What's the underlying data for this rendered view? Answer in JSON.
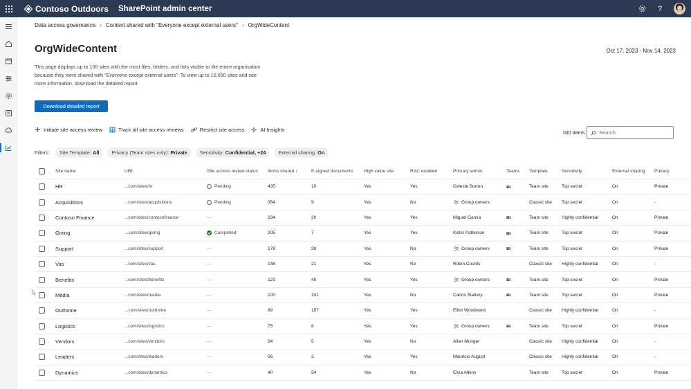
{
  "topbar": {
    "brand": "Contoso Outdoors",
    "app": "SharePoint admin center"
  },
  "icons": {
    "waffle": "app-launcher-icon",
    "settings": "gear-icon",
    "help": "help-icon",
    "search": "search-icon"
  },
  "breadcrumb": [
    "Data access governance",
    "Content shared with \"Everyone except external users\"",
    "OrgWideContent"
  ],
  "page": {
    "title": "OrgWideContent",
    "date_range": "Oct 17, 2023 - Nov 14, 2023",
    "description": "This page displays up to 100 sites with the most files, folders, and lists visible to the entire organisation because they were shared with \"Everyone except external users\". To view up to 10,000 sites and see more information, download the detailed report.",
    "download_button": "Download detailed report"
  },
  "commands": [
    {
      "label": "Initiate site access review",
      "icon": "add-icon"
    },
    {
      "label": "Track all site access reviews",
      "icon": "grid-icon"
    },
    {
      "label": "Restrict site access",
      "icon": "link-icon"
    },
    {
      "label": "AI Insights",
      "icon": "sparkle-icon"
    }
  ],
  "items_count": "100 items",
  "search_placeholder": "Search",
  "filters": {
    "label": "Filters:",
    "pills": [
      {
        "name": "Site Template:",
        "value": "All"
      },
      {
        "name": "Privacy (Team sites only):",
        "value": "Private"
      },
      {
        "name": "Sensitivity:",
        "value": "Confidential, +24"
      },
      {
        "name": "External sharing:",
        "value": "On"
      }
    ]
  },
  "columns": {
    "site_name": "Site name",
    "url": "URL",
    "status": "Site access review status",
    "items": "Items shared ↓",
    "esign": "E-signed documents",
    "hv": "High value site",
    "rac": "RAC enabled",
    "admin": "Primary admin",
    "teams": "Teams",
    "template": "Template",
    "sens": "Sensitivity",
    "ext": "External sharing",
    "priv": "Privacy"
  },
  "rows": [
    {
      "name": "HR",
      "url": "...com/sites/hr",
      "status": "Pending",
      "status_type": "pending",
      "items": "435",
      "esign": "10",
      "hv": "Yes",
      "rac": "Yes",
      "admin": "Celeste Burton",
      "admin_group": false,
      "teams": true,
      "template": "Team site",
      "sens": "Top secret",
      "ext": "On",
      "priv": "Private"
    },
    {
      "name": "Acquisitions",
      "url": "...com/sites/acquisitions",
      "status": "Pending",
      "status_type": "pending",
      "items": "354",
      "esign": "9",
      "hv": "Yes",
      "rac": "No",
      "admin": "Group owners",
      "admin_group": true,
      "teams": false,
      "template": "Classic site",
      "sens": "Top secret",
      "ext": "On",
      "priv": "-"
    },
    {
      "name": "Contoso Finance",
      "url": "...com/sites/contosofinance",
      "status": "—",
      "status_type": "none",
      "items": "234",
      "esign": "20",
      "hv": "Yes",
      "rac": "Yes",
      "admin": "Miguel Garcia",
      "admin_group": false,
      "teams": true,
      "template": "Team site",
      "sens": "Highly confidential",
      "ext": "On",
      "priv": "Private"
    },
    {
      "name": "Giving",
      "url": "...com/sites/giving",
      "status": "Completed",
      "status_type": "completed",
      "items": "205",
      "esign": "7",
      "hv": "Yes",
      "rac": "Yes",
      "admin": "Kistin Patterson",
      "admin_group": false,
      "teams": true,
      "template": "Team site",
      "sens": "Top secret",
      "ext": "On",
      "priv": "Private"
    },
    {
      "name": "Support",
      "url": "...com/sites/support",
      "status": "—",
      "status_type": "none",
      "items": "178",
      "esign": "38",
      "hv": "Yes",
      "rac": "No",
      "admin": "Group owners",
      "admin_group": true,
      "teams": true,
      "template": "Team site",
      "sens": "Top secret",
      "ext": "On",
      "priv": "Private"
    },
    {
      "name": "Vas",
      "url": "...com/sites/vas",
      "status": "—",
      "status_type": "none",
      "items": "146",
      "esign": "21",
      "hv": "Yes",
      "rac": "No",
      "admin": "Robin Counts",
      "admin_group": false,
      "teams": false,
      "template": "Classic site",
      "sens": "Highly confidential",
      "ext": "On",
      "priv": "-"
    },
    {
      "name": "Benefits",
      "url": "...com/sites/benefits",
      "status": "—",
      "status_type": "none",
      "items": "123",
      "esign": "45",
      "hv": "Yes",
      "rac": "Yes",
      "admin": "Group owners",
      "admin_group": true,
      "teams": true,
      "template": "Team site",
      "sens": "Top secret",
      "ext": "On",
      "priv": "Private"
    },
    {
      "name": "Media",
      "url": "...com/sites/media",
      "status": "—",
      "status_type": "none",
      "items": "100",
      "esign": "101",
      "hv": "Yes",
      "rac": "No",
      "admin": "Carlos Slattery",
      "admin_group": false,
      "teams": true,
      "template": "Team site",
      "sens": "Top secret",
      "ext": "On",
      "priv": "Private"
    },
    {
      "name": "Outhome",
      "url": "...com/sites/outhome",
      "status": "—",
      "status_type": "none",
      "items": "89",
      "esign": "157",
      "hv": "Yes",
      "rac": "Yes",
      "admin": "Elliot Woodward",
      "admin_group": false,
      "teams": false,
      "template": "Classic site",
      "sens": "Highly confidential",
      "ext": "On",
      "priv": "-"
    },
    {
      "name": "Logistics",
      "url": "...com/sites/logistics",
      "status": "—",
      "status_type": "none",
      "items": "75",
      "esign": "8",
      "hv": "Yes",
      "rac": "Yes",
      "admin": "Group owners",
      "admin_group": true,
      "teams": true,
      "template": "Team site",
      "sens": "Top secret",
      "ext": "On",
      "priv": "Private"
    },
    {
      "name": "Vendors",
      "url": "...com/sites/vendors",
      "status": "—",
      "status_type": "none",
      "items": "64",
      "esign": "5",
      "hv": "Yes",
      "rac": "No",
      "admin": "Allan Munger",
      "admin_group": false,
      "teams": false,
      "template": "Classic site",
      "sens": "Highly confidential",
      "ext": "On",
      "priv": "-"
    },
    {
      "name": "Leaders",
      "url": "...com/sites/leaders",
      "status": "—",
      "status_type": "none",
      "items": "56",
      "esign": "3",
      "hv": "Yes",
      "rac": "Yes",
      "admin": "Mauricio August",
      "admin_group": false,
      "teams": false,
      "template": "Classic site",
      "sens": "Highly confidential",
      "ext": "On",
      "priv": "-"
    },
    {
      "name": "Dynamics",
      "url": "...com/sites/dynamics",
      "status": "—",
      "status_type": "none",
      "items": "40",
      "esign": "54",
      "hv": "Yes",
      "rac": "No",
      "admin": "Elvia Atkins",
      "admin_group": false,
      "teams": false,
      "template": "Team site",
      "sens": "Top secret",
      "ext": "On",
      "priv": "Private"
    }
  ],
  "colors": {
    "topbar": "#2b3a52",
    "primary": "#0f6cbd",
    "completed": "#107c10"
  }
}
